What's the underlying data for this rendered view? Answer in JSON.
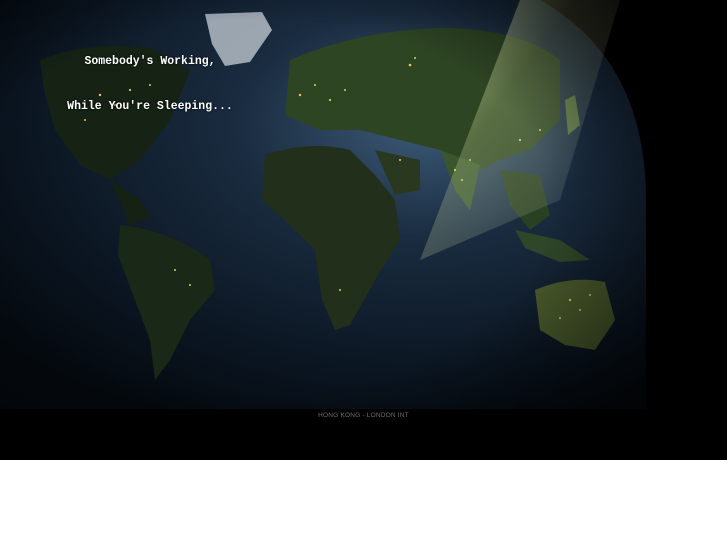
{
  "banner": {
    "tagline_line1": "Somebody's Working,",
    "tagline_line2": "While You're Sleeping...",
    "footer_link": "HONG KONG - LONDON INT"
  },
  "colors": {
    "background": "#000000",
    "page": "#ffffff",
    "tagline": "#ffffff",
    "footer_text": "#6f6f6f",
    "ocean": "#0d1a2a",
    "land_night": "#1c2a1a",
    "land_day": "#4a6b35",
    "city_lights": "#e8c46a"
  },
  "icons": {
    "earth_image": "night-earth-map"
  }
}
